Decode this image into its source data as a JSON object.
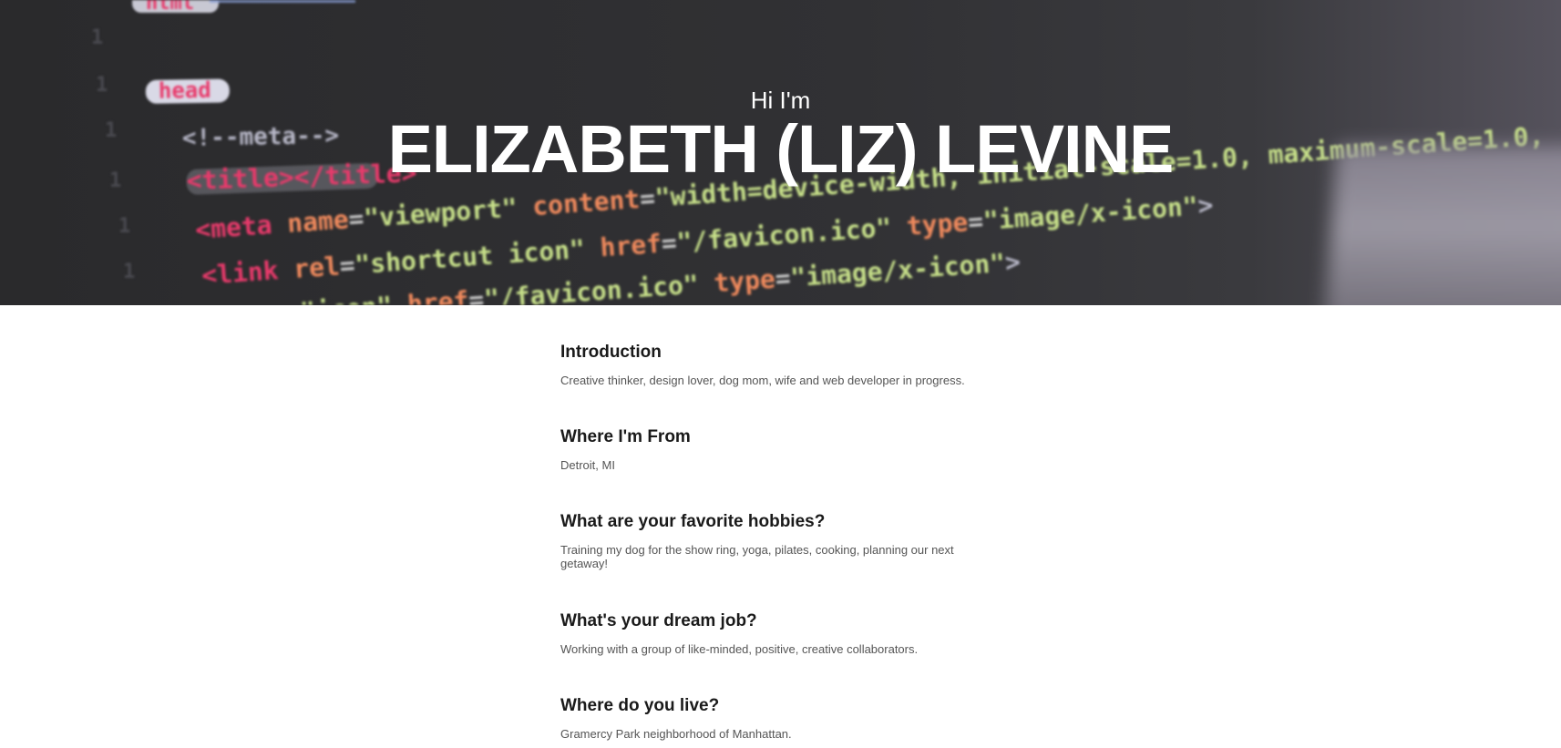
{
  "hero": {
    "greeting": "Hi I'm",
    "name": "ELIZABETH (LIZ) LEVINE"
  },
  "sections": [
    {
      "heading": "Introduction",
      "body": "Creative thinker, design lover, dog mom, wife and web developer in progress."
    },
    {
      "heading": "Where I'm From",
      "body": "Detroit, MI"
    },
    {
      "heading": "What are your favorite hobbies?",
      "body": "Training my dog for the show ring, yoga, pilates, cooking, planning our next getaway!"
    },
    {
      "heading": "What's your dream job?",
      "body": "Working with a group of like-minded, positive, creative collaborators."
    },
    {
      "heading": "Where do you live?",
      "body": "Gramercy Park neighborhood of Manhattan."
    }
  ],
  "colors": {
    "hero_background": "#2f2f31",
    "code_tag_pink": "#e83a6b",
    "code_attr_orange": "#f08a5d",
    "code_string_green": "#c7e08a",
    "heading_text": "#1a1a1a",
    "body_text": "#555555"
  }
}
